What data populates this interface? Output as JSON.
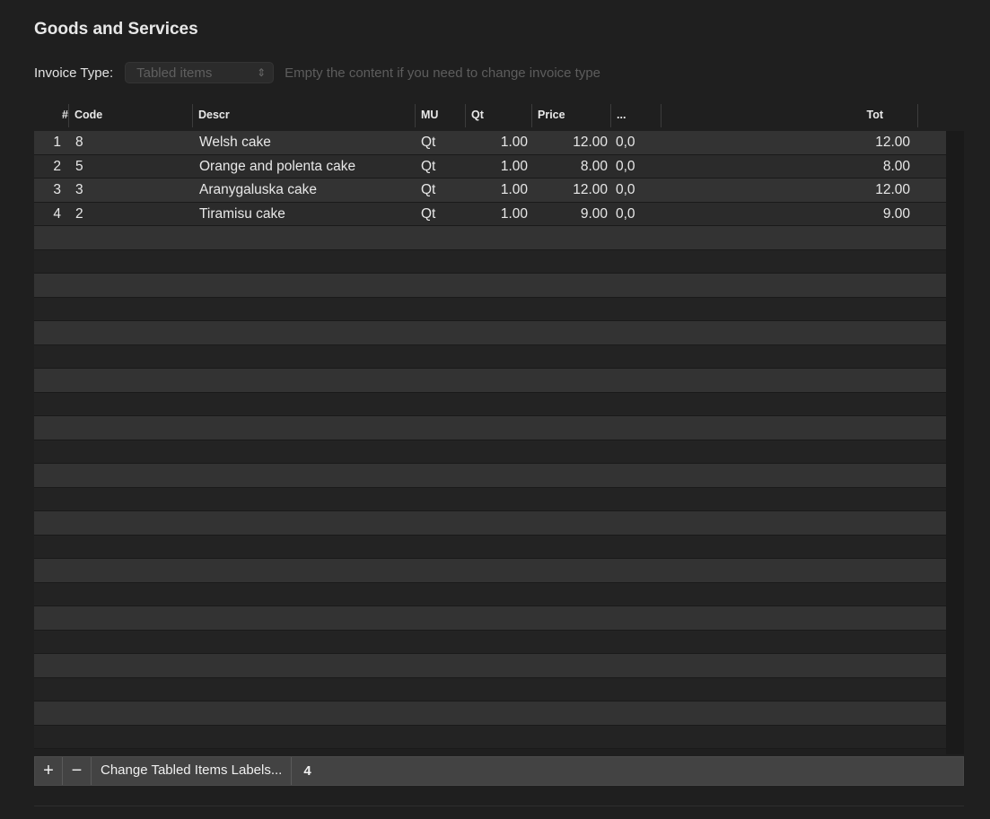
{
  "section_title": "Goods and Services",
  "invoice_type": {
    "label": "Invoice Type:",
    "selected": "Tabled items",
    "hint": "Empty the content if you need to change invoice type"
  },
  "table": {
    "headers": {
      "num": "#",
      "code": "Code",
      "descr": "Descr",
      "mu": "MU",
      "qt": "Qt",
      "price": "Price",
      "extra": "...",
      "tot": "Tot"
    },
    "rows": [
      {
        "num": "1",
        "code": "8",
        "descr": "Welsh cake",
        "mu": "Qt",
        "qt": "1.00",
        "price": "12.00",
        "extra": "0,0",
        "tot": "12.00"
      },
      {
        "num": "2",
        "code": "5",
        "descr": "Orange and polenta cake",
        "mu": "Qt",
        "qt": "1.00",
        "price": "8.00",
        "extra": "0,0",
        "tot": "8.00"
      },
      {
        "num": "3",
        "code": "3",
        "descr": "Aranygaluska cake",
        "mu": "Qt",
        "qt": "1.00",
        "price": "12.00",
        "extra": "0,0",
        "tot": "12.00"
      },
      {
        "num": "4",
        "code": "2",
        "descr": "Tiramisu cake",
        "mu": "Qt",
        "qt": "1.00",
        "price": "9.00",
        "extra": "0,0",
        "tot": "9.00"
      }
    ]
  },
  "bottom_bar": {
    "add_label": "+",
    "remove_label": "−",
    "change_labels": "Change Tabled Items Labels...",
    "count": "4"
  },
  "icons": {
    "popup_chevron": "chevron-up-down-icon"
  },
  "colors": {
    "background": "#1f1f1f",
    "row_alt": "#333333",
    "disabled_text": "#5d5d5d"
  }
}
